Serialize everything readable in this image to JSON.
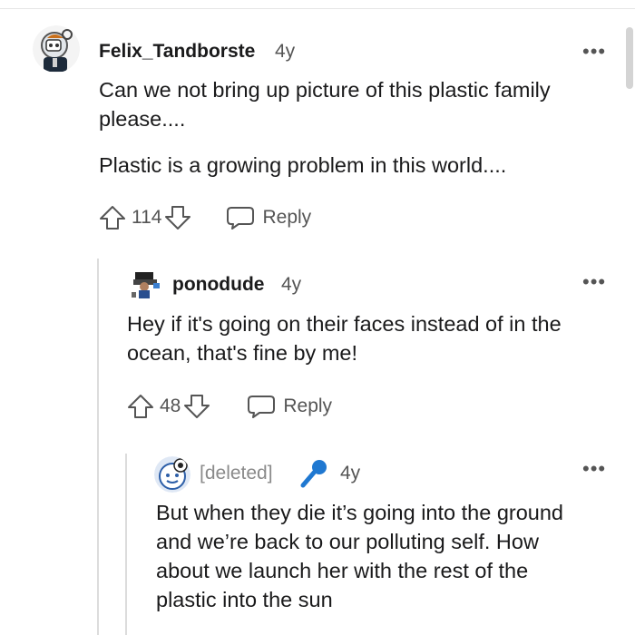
{
  "comments": [
    {
      "author": "Felix_Tandborste",
      "age": "4y",
      "more": "•••",
      "paragraphs": [
        "Can we not bring up picture of this plastic family please....",
        "Plastic is a growing problem in this world...."
      ],
      "score": "114",
      "reply_label": "Reply"
    },
    {
      "author": "ponodude",
      "age": "4y",
      "more": "•••",
      "paragraphs": [
        "Hey if it's going on their faces instead of in the ocean, that's fine by me!"
      ],
      "score": "48",
      "reply_label": "Reply"
    },
    {
      "author": "[deleted]",
      "age": "4y",
      "more": "•••",
      "paragraphs": [
        "But when they die it’s going into the ground and we’re back to our polluting self. How about we launch her with the rest of the plastic into the sun"
      ]
    }
  ],
  "colors": {
    "text": "#1a1a1b",
    "muted": "#555555",
    "deleted": "#8a8a8a",
    "thread_line": "#dcdcdc",
    "flair_blue": "#1f78d1"
  }
}
